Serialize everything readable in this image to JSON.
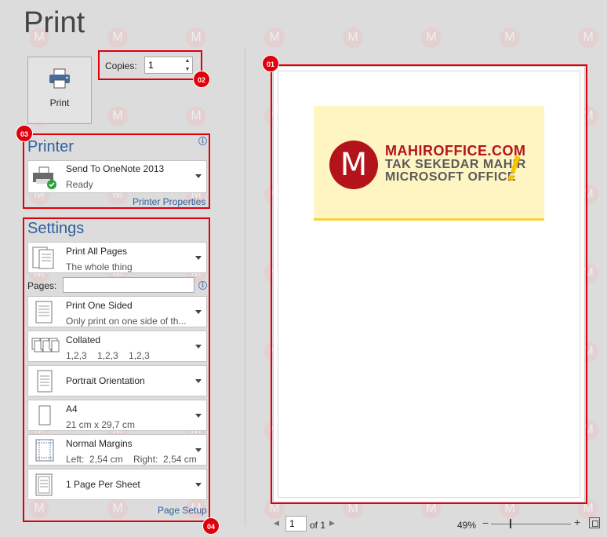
{
  "title": "Print",
  "print_button": {
    "label": "Print",
    "icon": "printer-icon"
  },
  "copies": {
    "label": "Copies:",
    "value": "1"
  },
  "printer": {
    "section_title": "Printer",
    "name": "Send To OneNote 2013",
    "status": "Ready",
    "properties_link": "Printer Properties"
  },
  "settings": {
    "section_title": "Settings",
    "pages_label": "Pages:",
    "pages_value": "",
    "items": [
      {
        "line1": "Print All Pages",
        "line2": "The whole thing",
        "icon": "pages-icon"
      },
      {
        "line1": "Print One Sided",
        "line2": "Only print on one side of th...",
        "icon": "one-sided-icon"
      },
      {
        "line1": "Collated",
        "line2": "1,2,3    1,2,3    1,2,3",
        "icon": "collated-icon"
      },
      {
        "line1": "Portrait Orientation",
        "line2": "",
        "icon": "portrait-icon"
      },
      {
        "line1": "A4",
        "line2": "21 cm x 29,7 cm",
        "icon": "paper-size-icon"
      },
      {
        "line1": "Normal Margins",
        "line2": "Left:  2,54 cm    Right:  2,54 cm",
        "icon": "margins-icon"
      },
      {
        "line1": "1 Page Per Sheet",
        "line2": "",
        "icon": "pages-per-sheet-icon"
      }
    ],
    "page_setup_link": "Page Setup"
  },
  "callouts": [
    "01",
    "02",
    "03",
    "04"
  ],
  "preview": {
    "banner_letter": "M",
    "banner_line1": "MAHIROFFICE.COM",
    "banner_line2": "TAK SEKEDAR MAHIR",
    "banner_line3": "MICROSOFT OFFICE",
    "banner_mark": "!"
  },
  "status_bar": {
    "current_page": "1",
    "of_label": "of 1",
    "zoom": "49%",
    "zoom_level_percent": 49
  },
  "watermark_letter": "M",
  "colors": {
    "accent": "#2e5f9e",
    "callout": "#e0000b",
    "brand": "#b3141b"
  }
}
